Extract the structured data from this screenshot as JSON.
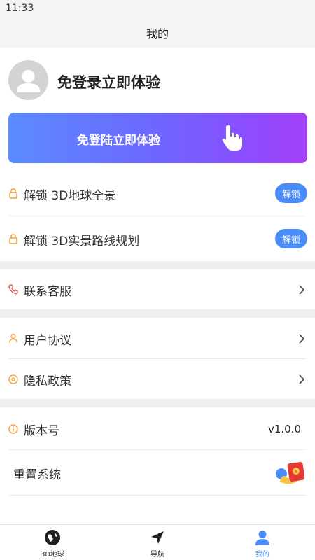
{
  "status": {
    "time": "11:33"
  },
  "header": {
    "title": "我的"
  },
  "profile": {
    "name": "免登录立即体验"
  },
  "banner": {
    "label": "免登陆立即体验"
  },
  "unlock_items": [
    {
      "label": "解锁 3D地球全景",
      "button": "解锁"
    },
    {
      "label": "解锁 3D实景路线规划",
      "button": "解锁"
    }
  ],
  "menu": {
    "contact": "联系客服",
    "agreement": "用户协议",
    "privacy": "隐私政策",
    "version_label": "版本号",
    "version_value": "v1.0.0",
    "reset": "重置系统"
  },
  "tabs": [
    {
      "label": "3D地球"
    },
    {
      "label": "导航"
    },
    {
      "label": "我的"
    }
  ],
  "colors": {
    "accent": "#4a8df8",
    "gradient_start": "#5b8cff",
    "gradient_end": "#a440f7",
    "icon_orange": "#f0a030",
    "icon_red": "#d9534f"
  }
}
